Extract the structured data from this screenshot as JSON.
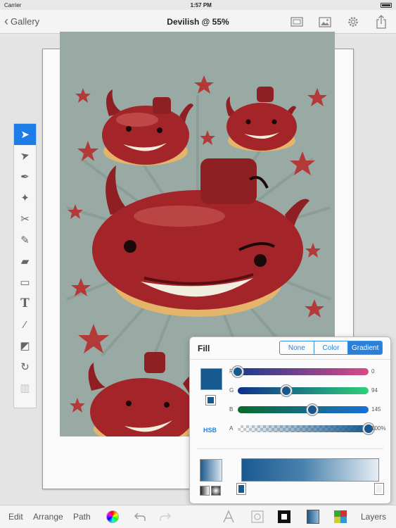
{
  "status": {
    "carrier": "Carrier",
    "time": "1:57 PM"
  },
  "nav": {
    "back_label": "Gallery",
    "title": "Devilish @ 55%",
    "icons": [
      "fullscreen-icon",
      "image-icon",
      "gear-icon",
      "share-icon"
    ]
  },
  "toolbox": {
    "tools": [
      {
        "name": "selection-tool-icon",
        "glyph": "➤",
        "active": true
      },
      {
        "name": "direct-selection-tool-icon",
        "glyph": "➤",
        "active": false
      },
      {
        "name": "pen-tool-icon",
        "glyph": "✒",
        "active": false
      },
      {
        "name": "add-anchor-tool-icon",
        "glyph": "✦",
        "active": false
      },
      {
        "name": "scissors-tool-icon",
        "glyph": "✂",
        "active": false
      },
      {
        "name": "brush-tool-icon",
        "glyph": "✎",
        "active": false
      },
      {
        "name": "eraser-tool-icon",
        "glyph": "▰",
        "active": false
      },
      {
        "name": "rectangle-tool-icon",
        "glyph": "▭",
        "active": false
      },
      {
        "name": "text-tool-icon",
        "glyph": "T",
        "active": false
      },
      {
        "name": "eyedropper-tool-icon",
        "glyph": "⁄",
        "active": false
      },
      {
        "name": "gradient-tool-icon",
        "glyph": "◩",
        "active": false
      },
      {
        "name": "rotate-tool-icon",
        "glyph": "↻",
        "active": false
      },
      {
        "name": "trash-icon",
        "glyph": "▥",
        "active": false,
        "disabled": true
      }
    ]
  },
  "fill_panel": {
    "title": "Fill",
    "modes": [
      "None",
      "Color",
      "Gradient"
    ],
    "selected_mode": "Gradient",
    "color_hex": "#16598e",
    "hsb_label": "HSB",
    "channels": [
      {
        "label": "R",
        "value": "0",
        "fraction": 0.0
      },
      {
        "label": "G",
        "value": "94",
        "fraction": 0.369
      },
      {
        "label": "B",
        "value": "145",
        "fraction": 0.569
      },
      {
        "label": "A",
        "value": "100%",
        "fraction": 1.0
      }
    ],
    "gradient": {
      "start_color": "#1a5990",
      "end_color": "#e6eef4"
    }
  },
  "bottom_bar": {
    "edit": "Edit",
    "arrange": "Arrange",
    "path": "Path",
    "layers": "Layers"
  },
  "colors": {
    "accent": "#1e7ce8",
    "artwork_bg": "#99aaa4",
    "devil_red": "#a3252a",
    "star_red": "#b43a3a"
  }
}
